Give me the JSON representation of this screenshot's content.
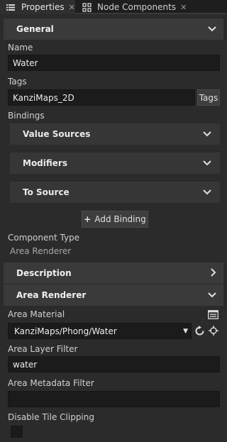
{
  "tabs": [
    {
      "label": "Properties",
      "icon": "list-icon",
      "active": true
    },
    {
      "label": "Node Components",
      "icon": "components-icon",
      "active": false
    }
  ],
  "general": {
    "title": "General",
    "name_label": "Name",
    "name_value": "Water",
    "tags_label": "Tags",
    "tags_value": "KanziMaps_2D",
    "tags_button": "Tags",
    "bindings_label": "Bindings",
    "value_sources": "Value Sources",
    "modifiers": "Modifiers",
    "to_source": "To Source",
    "add_binding": "Add Binding",
    "component_type_label": "Component Type",
    "component_type_value": "Area Renderer"
  },
  "description": {
    "title": "Description"
  },
  "area_renderer": {
    "title": "Area Renderer",
    "material_label": "Area Material",
    "material_value": "KanziMaps/Phong/Water",
    "layer_filter_label": "Area Layer Filter",
    "layer_filter_value": "water",
    "metadata_filter_label": "Area Metadata Filter",
    "metadata_filter_value": "",
    "disable_clipping_label": "Disable Tile Clipping",
    "disable_clipping_checked": false
  }
}
